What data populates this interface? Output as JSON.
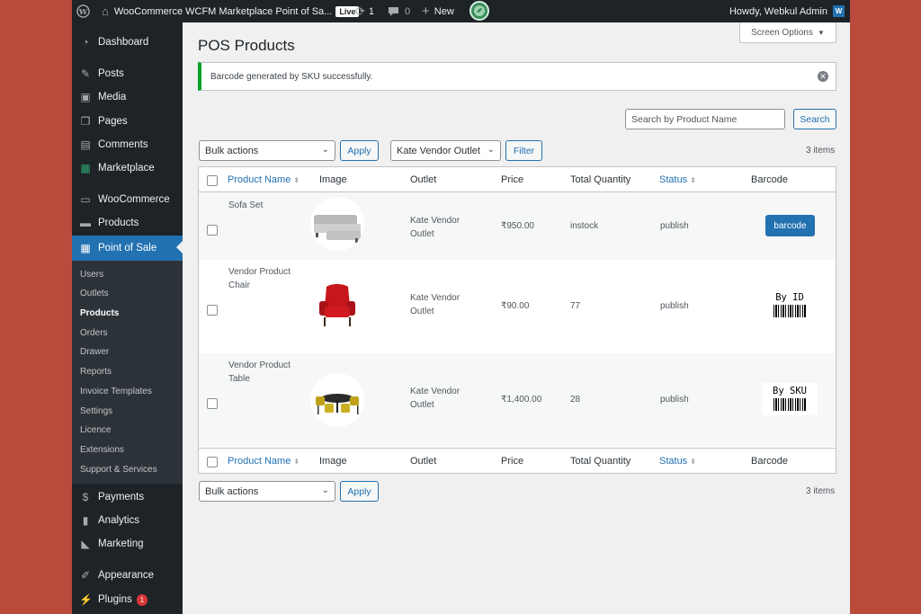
{
  "adminbar": {
    "site_title": "WooCommerce WCFM Marketplace Point of Sa...",
    "live_badge": "Live",
    "updates_count": "1",
    "comments_count": "0",
    "new_label": "New",
    "howdy": "Howdy, Webkul Admin"
  },
  "sidebar": {
    "menu": [
      {
        "label": "Dashboard",
        "icon": "dashboard-icon"
      },
      {
        "label": "Posts",
        "icon": "pin-icon"
      },
      {
        "label": "Media",
        "icon": "media-icon"
      },
      {
        "label": "Pages",
        "icon": "pages-icon"
      },
      {
        "label": "Comments",
        "icon": "comment-icon"
      },
      {
        "label": "Marketplace",
        "icon": "marketplace-icon"
      },
      {
        "label": "WooCommerce",
        "icon": "woo-icon"
      },
      {
        "label": "Products",
        "icon": "archive-icon"
      },
      {
        "label": "Point of Sale",
        "icon": "calculator-icon"
      },
      {
        "label": "Payments",
        "icon": "dollar-icon"
      },
      {
        "label": "Analytics",
        "icon": "chart-bar-icon"
      },
      {
        "label": "Marketing",
        "icon": "megaphone-icon"
      },
      {
        "label": "Appearance",
        "icon": "brush-icon"
      },
      {
        "label": "Plugins",
        "icon": "plug-icon",
        "badge": "1"
      }
    ],
    "submenu": [
      "Users",
      "Outlets",
      "Products",
      "Orders",
      "Drawer",
      "Reports",
      "Invoice Templates",
      "Settings",
      "Licence",
      "Extensions",
      "Support & Services"
    ]
  },
  "screen_options": "Screen Options",
  "page_title": "POS Products",
  "notice": "Barcode generated by SKU successfully.",
  "search": {
    "placeholder": "Search by Product Name",
    "button": "Search"
  },
  "bulk": {
    "label": "Bulk actions",
    "apply": "Apply"
  },
  "outlet_filter": {
    "label": "Kate Vendor Outlet",
    "button": "Filter"
  },
  "items_count": "3 items",
  "columns": [
    "Product Name",
    "Image",
    "Outlet",
    "Price",
    "Total Quantity",
    "Status",
    "Barcode"
  ],
  "rows": [
    {
      "name": "Sofa Set",
      "outlet": "Kate Vendor Outlet",
      "price": "₹950.00",
      "quantity": "instock",
      "status": "publish",
      "barcode": "barcode"
    },
    {
      "name": "Vendor Product Chair",
      "outlet": "Kate Vendor Outlet",
      "price": "₹90.00",
      "quantity": "77",
      "status": "publish",
      "barcode": "By ID"
    },
    {
      "name": "Vendor Product Table",
      "outlet": "Kate Vendor Outlet",
      "price": "₹1,400.00",
      "quantity": "28",
      "status": "publish",
      "barcode": "By SKU"
    }
  ],
  "colors": {
    "accent": "#2271b1",
    "success": "#00a32a",
    "admin_dark": "#1d2327"
  }
}
